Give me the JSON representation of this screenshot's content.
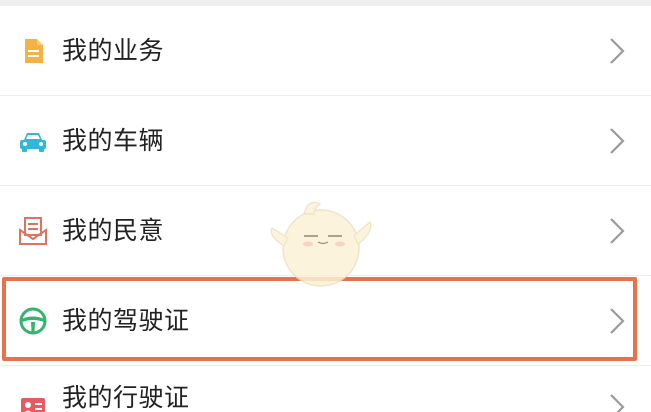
{
  "menu": {
    "items": [
      {
        "label": "我的业务",
        "icon": "document-icon"
      },
      {
        "label": "我的车辆",
        "icon": "car-icon"
      },
      {
        "label": "我的民意",
        "icon": "envelope-letter-icon"
      },
      {
        "label": "我的驾驶证",
        "icon": "steering-wheel-icon",
        "highlighted": true
      },
      {
        "label": "我的行驶证",
        "icon": "id-card-icon"
      }
    ]
  },
  "colors": {
    "highlight_border": "#e8734a",
    "document_icon": "#f4b245",
    "car_icon": "#2fb8d8",
    "envelope_icon": "#e0735f",
    "steering_icon": "#35b46c",
    "id_card_icon": "#e85a62",
    "chevron": "#9a9a9a"
  }
}
